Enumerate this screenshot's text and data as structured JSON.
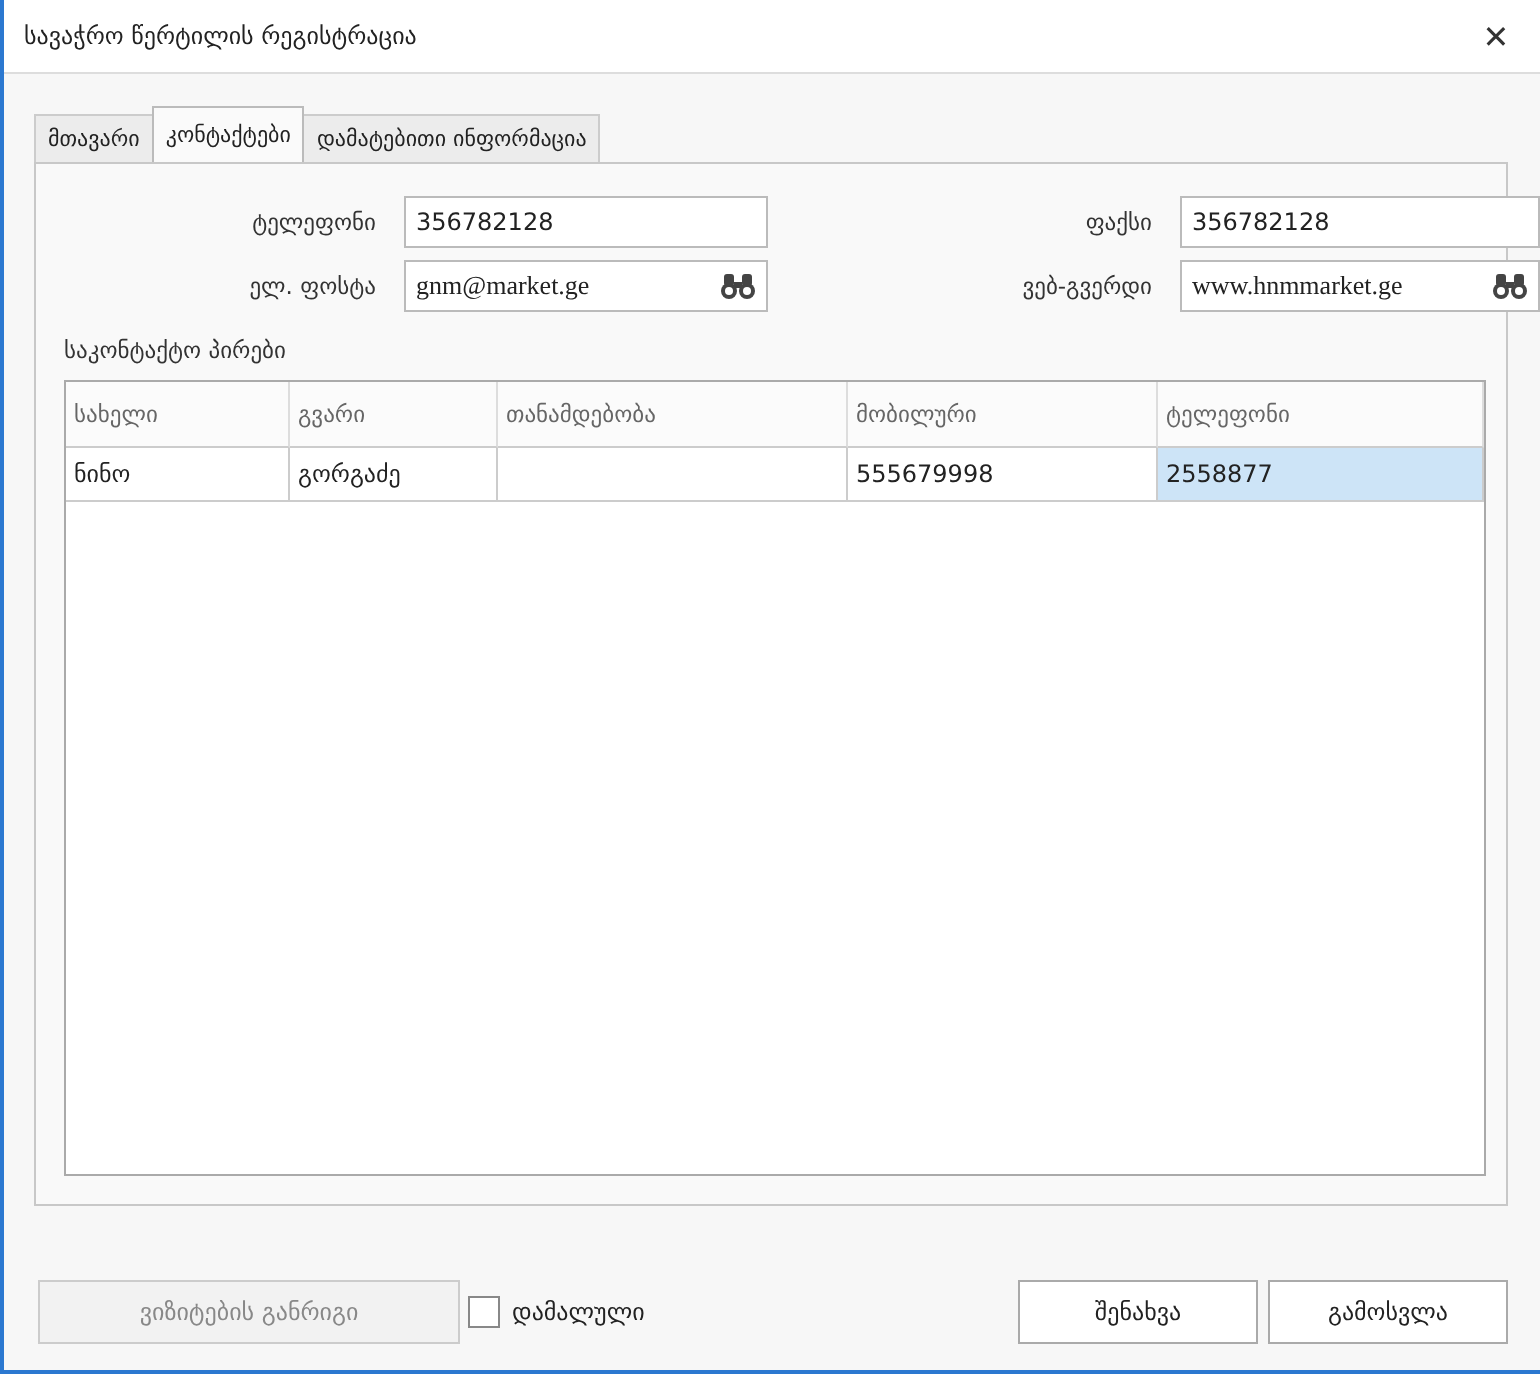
{
  "window": {
    "title": "სავაჭრო წერტილის რეგისტრაცია",
    "close": "✕"
  },
  "tabs": [
    {
      "label": "მთავარი",
      "selected": false
    },
    {
      "label": "კონტაქტები",
      "selected": true
    },
    {
      "label": "დამატებითი ინფორმაცია",
      "selected": false
    }
  ],
  "fields": [
    {
      "label": "ტელეფონი",
      "value": "356782128",
      "kind": "text"
    },
    {
      "label": "ფაქსი",
      "value": "356782128",
      "kind": "text"
    },
    {
      "label": "ელ. ფოსტა",
      "value": "gnm@market.ge",
      "kind": "lookup"
    },
    {
      "label": "ვებ-გვერდი",
      "value": "www.hnmmarket.ge",
      "kind": "lookup"
    }
  ],
  "contacts": {
    "title": "საკონტაქტო პირები",
    "columns": [
      "სახელი",
      "გვარი",
      "თანამდებობა",
      "მობილური",
      "ტელეფონი"
    ],
    "rows": [
      [
        {
          "text": "ნინო",
          "selected": false
        },
        {
          "text": "გორგაძე",
          "selected": false
        },
        {
          "selected": false
        },
        {
          "text": "555679998",
          "selected": false
        },
        {
          "text": "2558877",
          "selected": true
        }
      ]
    ]
  },
  "footer": {
    "schedule_button": {
      "label": "ვიზიტების განრიგი",
      "disabled": true
    },
    "hidden_checkbox": {
      "label": "დამალული",
      "checked": false
    },
    "buttons": [
      "შენახვა",
      "გამოსვლა"
    ]
  }
}
